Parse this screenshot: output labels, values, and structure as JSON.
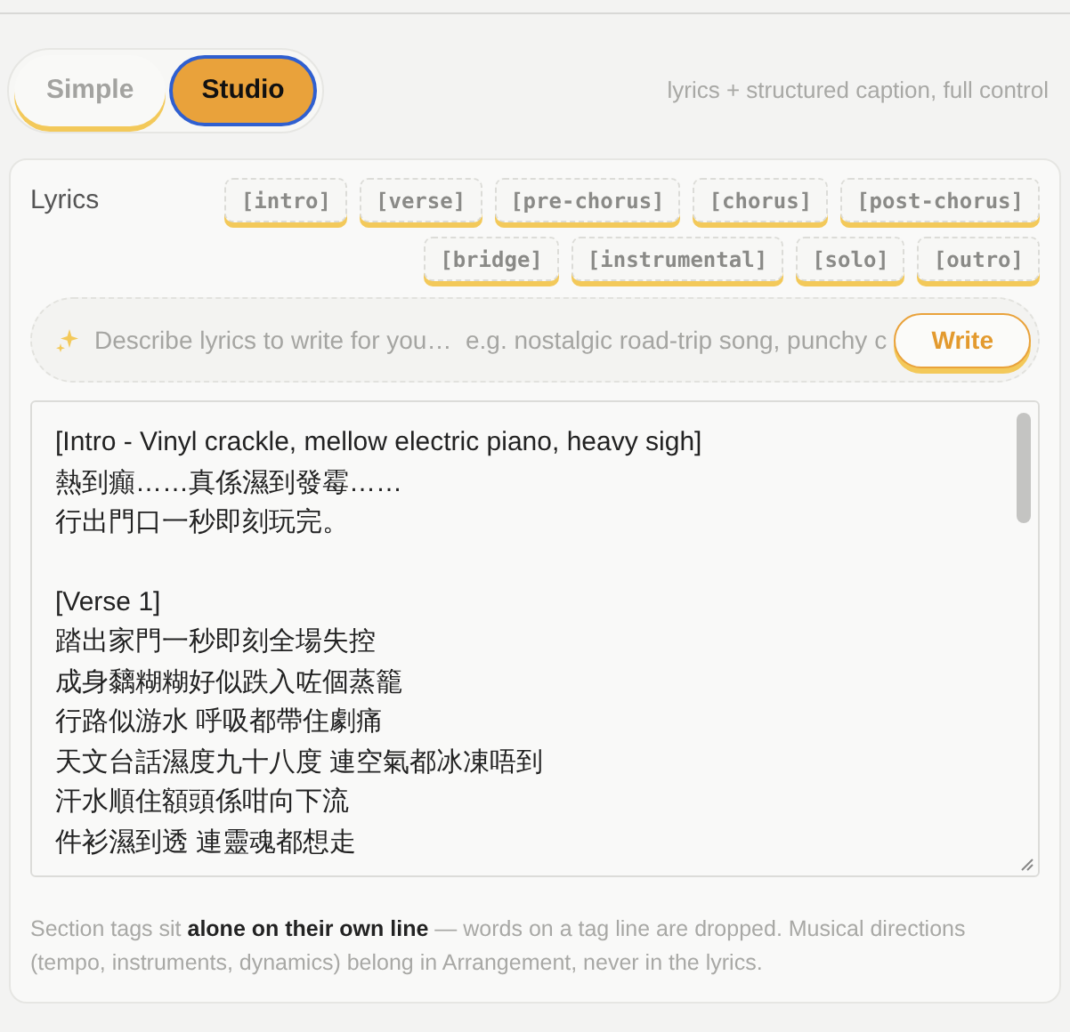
{
  "mode_tabs": [
    {
      "label": "Simple",
      "selected": false
    },
    {
      "label": "Studio",
      "selected": true
    }
  ],
  "mode_hint": "lyrics + structured caption, full control",
  "lyrics": {
    "label": "Lyrics",
    "tags": [
      "[intro]",
      "[verse]",
      "[pre-chorus]",
      "[chorus]",
      "[post-chorus]",
      "[bridge]",
      "[instrumental]",
      "[solo]",
      "[outro]"
    ],
    "prompt": {
      "placeholder": "Describe lyrics to write for you…  e.g. nostalgic road-trip song, punchy c",
      "button": "Write"
    },
    "stanzas": [
      [
        "[Intro - Vinyl crackle, mellow electric piano, heavy sigh]",
        "熱到癲……真係濕到發霉……",
        "行出門口一秒即刻玩完。"
      ],
      [
        "[Verse 1]",
        "踏出家門一秒即刻全場失控",
        "成身黐糊糊好似跌入咗個蒸籠",
        "行路似游水 呼吸都帶住劇痛",
        "天文台話濕度九十八度 連空氣都冰凍唔到",
        "汗水順住額頭係咁向下流",
        "件衫濕到透 連靈魂都想走"
      ]
    ],
    "note": "Section tags sit **alone on their own line** — words on a tag line are dropped. Musical directions (tempo, instruments, dynamics) belong in Arrangement, never in the lyrics."
  }
}
